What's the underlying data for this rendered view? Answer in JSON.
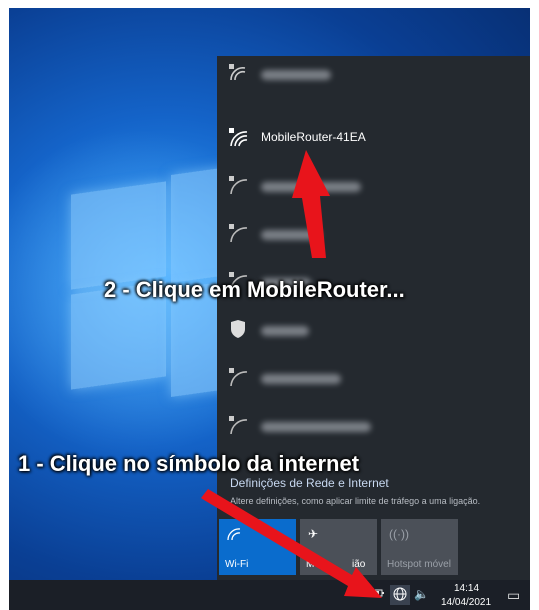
{
  "network_list": {
    "selected_network": "MobileRouter-41EA"
  },
  "settings": {
    "title": "Definições de Rede e Internet",
    "description": "Altere definições, como aplicar limite de tráfego a uma ligação."
  },
  "quick_actions": {
    "wifi_label": "Wi-Fi",
    "airplane_label_partial_left": "M",
    "airplane_label_partial_right": "ião",
    "hotspot_label": "Hotspot móvel"
  },
  "taskbar": {
    "time": "14:14",
    "date": "14/04/2021"
  },
  "annotations": {
    "step2": "2 - Clique em MobileRouter...",
    "step1": "1 - Clique no símbolo da internet"
  },
  "colors": {
    "flyout_bg": "#24292f",
    "wifi_tile": "#0a6ccd",
    "inactive_tile": "#4b5058",
    "arrow": "#e8141b"
  },
  "icons": {
    "wifi_secured": "wifi-lock-icon",
    "shield": "shield-icon",
    "airplane": "airplane-icon",
    "hotspot": "hotspot-icon",
    "network_tray": "globe-network-icon",
    "volume": "volume-icon",
    "notifications": "action-center-icon"
  }
}
